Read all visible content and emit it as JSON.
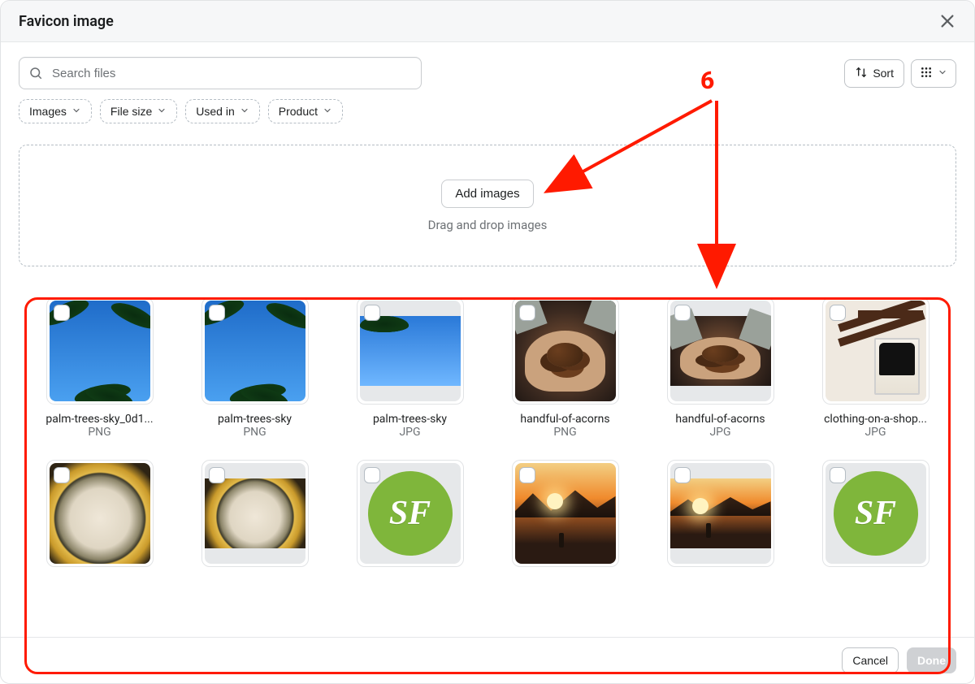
{
  "modal": {
    "title": "Favicon image"
  },
  "search": {
    "placeholder": "Search files"
  },
  "sort": {
    "label": "Sort"
  },
  "filters": [
    {
      "label": "Images"
    },
    {
      "label": "File size"
    },
    {
      "label": "Used in"
    },
    {
      "label": "Product"
    }
  ],
  "dropzone": {
    "button": "Add images",
    "hint": "Drag and drop images"
  },
  "files": [
    {
      "name": "palm-trees-sky_0d1...",
      "type": "PNG",
      "art": "palm-tall"
    },
    {
      "name": "palm-trees-sky",
      "type": "PNG",
      "art": "palm-tall"
    },
    {
      "name": "palm-trees-sky",
      "type": "JPG",
      "art": "palm-wide"
    },
    {
      "name": "handful-of-acorns",
      "type": "PNG",
      "art": "acorn-tall"
    },
    {
      "name": "handful-of-acorns",
      "type": "JPG",
      "art": "acorn-wide"
    },
    {
      "name": "clothing-on-a-shop...",
      "type": "JPG",
      "art": "shop"
    },
    {
      "name": "",
      "type": "",
      "art": "park-tall"
    },
    {
      "name": "",
      "type": "",
      "art": "park-wide"
    },
    {
      "name": "",
      "type": "",
      "art": "sf"
    },
    {
      "name": "",
      "type": "",
      "art": "beach-tall"
    },
    {
      "name": "",
      "type": "",
      "art": "beach-wide"
    },
    {
      "name": "",
      "type": "",
      "art": "sf"
    }
  ],
  "footer": {
    "cancel": "Cancel",
    "done": "Done"
  },
  "annotation": {
    "number": "6"
  }
}
